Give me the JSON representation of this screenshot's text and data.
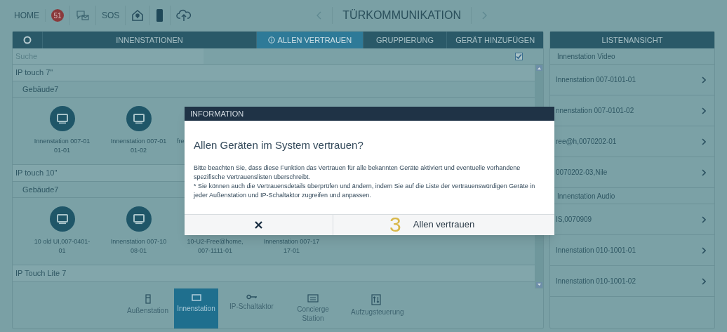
{
  "top_bar": {
    "home": "HOME",
    "badge": "51",
    "sos": "SOS",
    "title": "TÜRKOMMUNIKATION"
  },
  "left_panel": {
    "tabs": [
      {
        "label": "INNENSTATIONEN",
        "selected": false,
        "kind": "plain"
      },
      {
        "label": "ALLEN VERTRAUEN",
        "selected": true,
        "kind": "info"
      },
      {
        "label": "GRUPPIERUNG",
        "selected": false,
        "kind": "plain"
      },
      {
        "label": "GERÄT HINZUFÜGEN",
        "selected": false,
        "kind": "plain"
      }
    ],
    "search": {
      "placeholder": "Suche",
      "checked": true
    },
    "groups": [
      {
        "title": "IP touch 7\"",
        "children": [
          {
            "title": "Gebäude7",
            "devices": [
              {
                "label": "Innenstation 007-0101-01",
                "kind": "video"
              },
              {
                "label": "Innenstation 007-0101-02",
                "kind": "video"
              },
              {
                "label": "fre",
                "kind": "covered"
              }
            ]
          }
        ]
      },
      {
        "title": "IP touch 10\"",
        "children": [
          {
            "title": "Gebäude7",
            "devices": [
              {
                "label": "10 old UI,007-0401-01",
                "kind": "video"
              },
              {
                "label": "Innenstation 007-1008-01",
                "kind": "video"
              },
              {
                "label": "10-U2-Free@home,007-1111-01",
                "kind": "video"
              },
              {
                "label": "Innenstation 007-1717-01",
                "kind": "video"
              }
            ]
          }
        ]
      },
      {
        "title": "IP Touch Lite 7"
      }
    ]
  },
  "bottom_nav": [
    {
      "label": "Außenstation",
      "selected": false,
      "kind": "outdoor"
    },
    {
      "label": "Innenstation",
      "selected": true,
      "kind": "indoor"
    },
    {
      "label": "IP-Schaltaktor",
      "selected": false,
      "kind": "switch"
    },
    {
      "label": "Concierge Station",
      "selected": false,
      "kind": "concierge"
    },
    {
      "label": "Aufzugsteuerung",
      "selected": false,
      "kind": "elevator"
    }
  ],
  "right_panel": {
    "title": "LISTENANSICHT",
    "sections": [
      {
        "title": "Innenstation Video",
        "items": [
          "Innenstation 007-0101-01",
          "nnenstation 007-0101-02",
          "ree@h,0070202-01",
          "0070202-03,Nile"
        ]
      },
      {
        "title": "Innenstation Audio",
        "items": [
          "IS,0070909",
          "Innenstation 010-1001-01",
          "Innenstation 010-1001-02"
        ]
      }
    ]
  },
  "dialog": {
    "title": "INFORMATION",
    "heading": "Allen Geräten im System vertrauen?",
    "body": [
      "Bitte beachten Sie, dass diese Funktion das Vertrauen für alle bekannten Geräte aktiviert und eventuelle vorhandene spezifische Vertrauenslisten überschreibt.",
      "* Sie können auch die Vertrauensdetails überprüfen und ändern, indem Sie auf die Liste der vertrauenswürdigen Geräte in jeder Außenstation und IP-Schaltaktor zugreifen und anpassen."
    ],
    "confirm": "Allen vertrauen",
    "step_marker": "3"
  }
}
